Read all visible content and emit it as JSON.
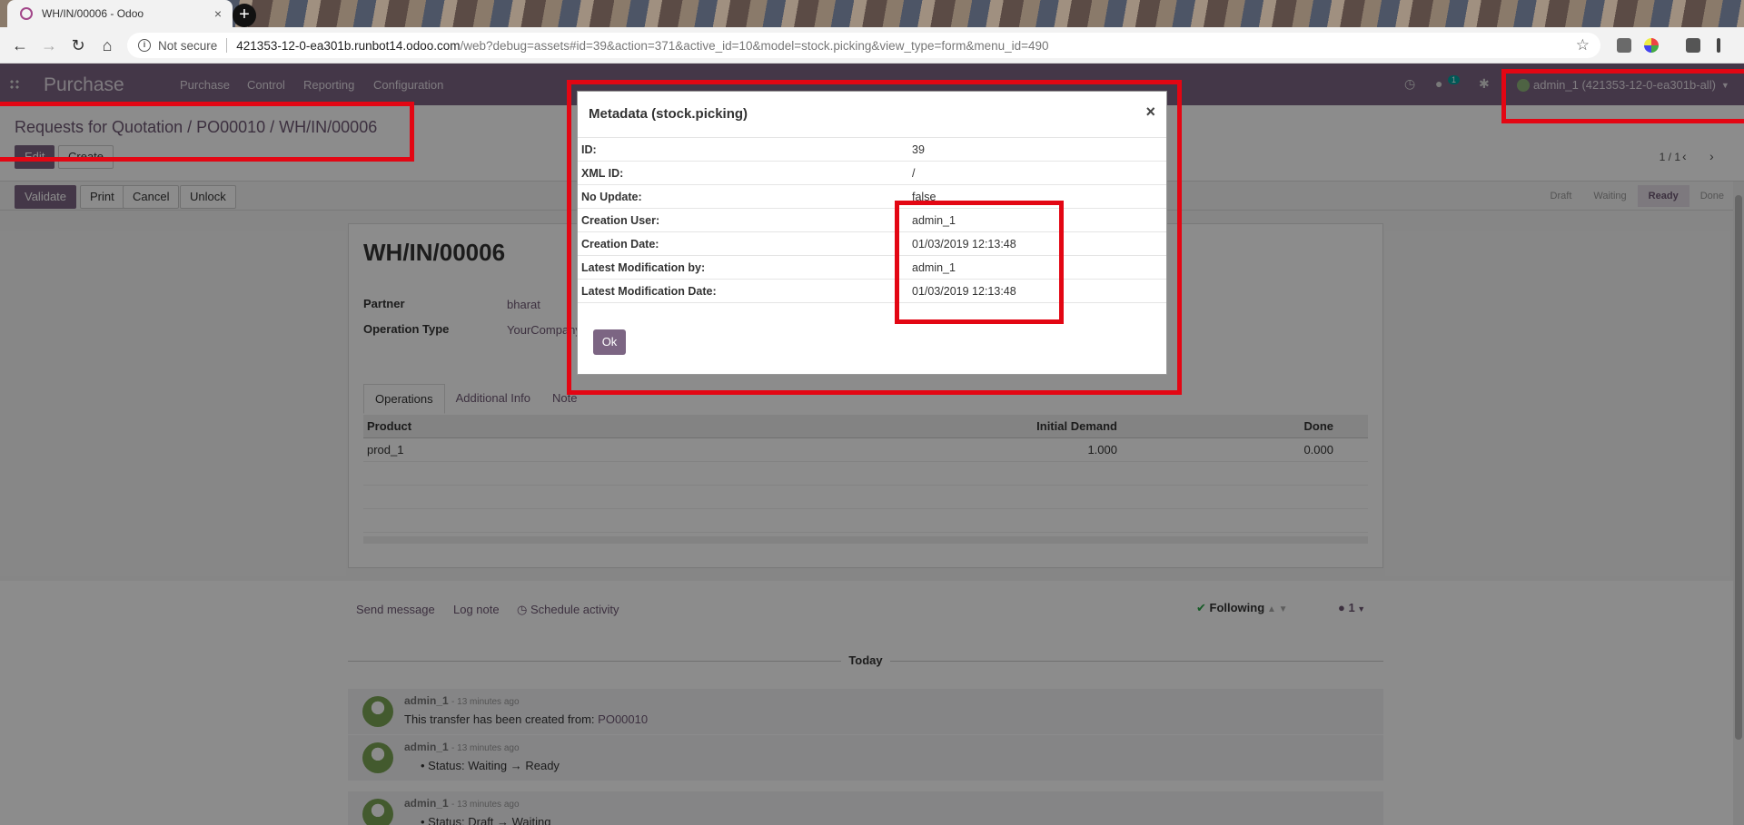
{
  "browser": {
    "tab_title": "WH/IN/00006 - Odoo",
    "tab_close": "×",
    "new_tab": "+",
    "not_secure": "Not secure",
    "url_host": "421353-12-0-ea301b.runbot14.odoo.com",
    "url_path": "/web?debug=assets#id=39&action=371&active_id=10&model=stock.picking&view_type=form&menu_id=490"
  },
  "odoo_nav": {
    "app_name": "Purchase",
    "menu": [
      "Purchase",
      "Control",
      "Reporting",
      "Configuration"
    ],
    "messages_count": "1",
    "user_label": "admin_1 (421353-12-0-ea301b-all)"
  },
  "control_panel": {
    "breadcrumb": "Requests for Quotation / PO00010 / WH/IN/00006",
    "edit_label": "Edit",
    "create_label": "Create",
    "pager": "1 / 1"
  },
  "actions": {
    "validate": "Validate",
    "print": "Print",
    "cancel": "Cancel",
    "unlock": "Unlock"
  },
  "statusbar": [
    "Draft",
    "Waiting",
    "Ready",
    "Done"
  ],
  "form": {
    "title": "WH/IN/00006",
    "partner_label": "Partner",
    "partner_value": "bharat",
    "operation_type_label": "Operation Type",
    "operation_type_value": "YourCompany",
    "tabs": [
      "Operations",
      "Additional Info",
      "Note"
    ],
    "columns": [
      "Product",
      "Initial Demand",
      "Done"
    ],
    "rows": [
      {
        "product": "prod_1",
        "initial_demand": "1.000",
        "done": "0.000"
      }
    ]
  },
  "chatter": {
    "send_message": "Send message",
    "log_note": "Log note",
    "schedule_activity": "Schedule activity",
    "following": "Following",
    "followers": "1",
    "today": "Today",
    "messages": [
      {
        "author": "admin_1",
        "ago": "- 13 minutes ago",
        "body_prefix": "This transfer has been created from: ",
        "link": "PO00010"
      },
      {
        "author": "admin_1",
        "ago": "- 13 minutes ago",
        "body_prefix": "Status: Waiting → Ready",
        "link": ""
      },
      {
        "author": "admin_1",
        "ago": "- 13 minutes ago",
        "body_prefix": "Status: Draft → Waiting",
        "link": ""
      }
    ]
  },
  "modal": {
    "title": "Metadata (stock.picking)",
    "close": "×",
    "rows": [
      {
        "key": "ID:",
        "value": "39"
      },
      {
        "key": "XML ID:",
        "value": "/"
      },
      {
        "key": "No Update:",
        "value": "false"
      },
      {
        "key": "Creation User:",
        "value": "admin_1"
      },
      {
        "key": "Creation Date:",
        "value": "01/03/2019 12:13:48"
      },
      {
        "key": "Latest Modification by:",
        "value": "admin_1"
      },
      {
        "key": "Latest Modification Date:",
        "value": "01/03/2019 12:13:48"
      }
    ],
    "ok_label": "Ok"
  },
  "colors": {
    "odoo_purple": "#7c6583",
    "annotation_red": "#e30613"
  }
}
